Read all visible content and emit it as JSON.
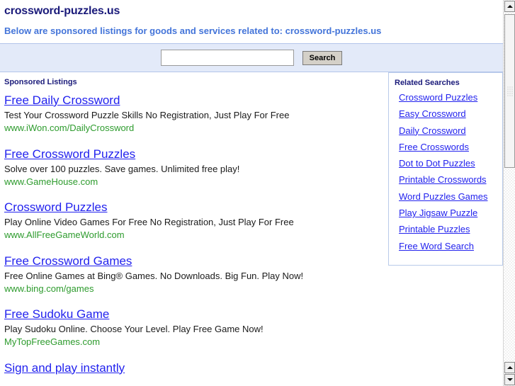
{
  "header": {
    "site_title": "crossword-puzzles.us",
    "subtitle": "Below are sponsored listings for goods and services related to: crossword-puzzles.us"
  },
  "search": {
    "value": "",
    "placeholder": "",
    "button_label": "Search"
  },
  "listings_section": {
    "label": "Sponsored Listings",
    "items": [
      {
        "title": "Free Daily Crossword",
        "description": "Test Your Crossword Puzzle Skills No Registration, Just Play For Free",
        "url": "www.iWon.com/DailyCrossword"
      },
      {
        "title": "Free Crossword Puzzles",
        "description": "Solve over 100 puzzles. Save games. Unlimited free play!",
        "url": "www.GameHouse.com"
      },
      {
        "title": "Crossword Puzzles",
        "description": "Play Online Video Games For Free No Registration, Just Play For Free",
        "url": "www.AllFreeGameWorld.com"
      },
      {
        "title": "Free Crossword Games",
        "description": "Free Online Games at Bing® Games. No Downloads. Big Fun. Play Now!",
        "url": "www.bing.com/games"
      },
      {
        "title": "Free Sudoku Game",
        "description": "Play Sudoku Online. Choose Your Level. Play Free Game Now!",
        "url": "MyTopFreeGames.com"
      },
      {
        "title": "Sign and play instantly",
        "description": "",
        "url": ""
      }
    ]
  },
  "related_searches": {
    "title": "Related Searches",
    "items": [
      "Crossword Puzzles",
      "Easy Crossword",
      "Daily Crossword",
      "Free Crosswords",
      "Dot to Dot Puzzles",
      "Printable Crosswords",
      "Word Puzzles Games",
      "Play Jigsaw Puzzle",
      "Printable Puzzles",
      "Free Word Search"
    ]
  },
  "colors": {
    "title_navy": "#1a1a7a",
    "subtitle_blue": "#4374d9",
    "link_blue": "#2222ee",
    "url_green": "#2d9b2d",
    "band_background": "#e3eaf9",
    "band_border": "#b3c5ea",
    "related_box_border": "#b9cbea"
  },
  "scrollbar": {
    "up_arrow": "scroll-up-arrow",
    "down_arrow": "scroll-down-arrow",
    "orientation": "vertical"
  }
}
